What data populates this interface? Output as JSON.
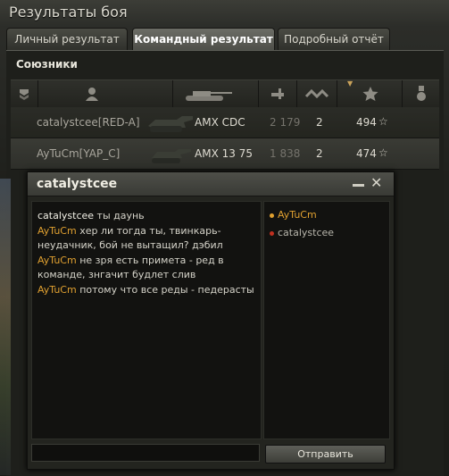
{
  "window": {
    "title": "Результаты боя"
  },
  "tabs": [
    {
      "label": "Личный результат",
      "active": false
    },
    {
      "label": "Командный результат",
      "active": true
    },
    {
      "label": "Подробный отчёт",
      "active": false
    }
  ],
  "team": {
    "section_title": "Союзники",
    "columns": [
      "platoon-icon",
      "player-icon",
      "tank-icon",
      "damage-icon",
      "frags-icon",
      "xp-star-icon",
      "medal-icon"
    ],
    "players": [
      {
        "name": "catalystcee[RED-A]",
        "vehicle": "AMX CDC",
        "damage": "2 179",
        "frags": "2",
        "xp": "494",
        "xp_icon": "☆"
      },
      {
        "name": "AyTuCm[YAP_C]",
        "vehicle": "AMX 13 75",
        "damage": "1 838",
        "frags": "2",
        "xp": "474",
        "xp_icon": "☆"
      }
    ]
  },
  "chat": {
    "title": "catalystcee",
    "messages": [
      {
        "sender": "catalystcee",
        "text": " ты даунь",
        "sender_color": "#f2f0e6"
      },
      {
        "sender": "AyTuCm",
        "text": " хер ли тогда ты, твинкарь-неудачник, бой не вытащил? дэбил",
        "sender_color": "#e0a030"
      },
      {
        "sender": "AyTuCm",
        "text": " не зря есть примета - ред в команде, знгачит будлет слив",
        "sender_color": "#e0a030"
      },
      {
        "sender": "AyTuCm",
        "text": " потому что все реды - педерасты",
        "sender_color": "#e0a030"
      }
    ],
    "users": [
      {
        "name": "AyTuCm",
        "color": "#e0a030",
        "dot": "#e0a030"
      },
      {
        "name": "catalystcee",
        "color": "#b8b6ac",
        "dot": "#c03020"
      }
    ],
    "input_value": "",
    "send_label": "Отправить"
  }
}
